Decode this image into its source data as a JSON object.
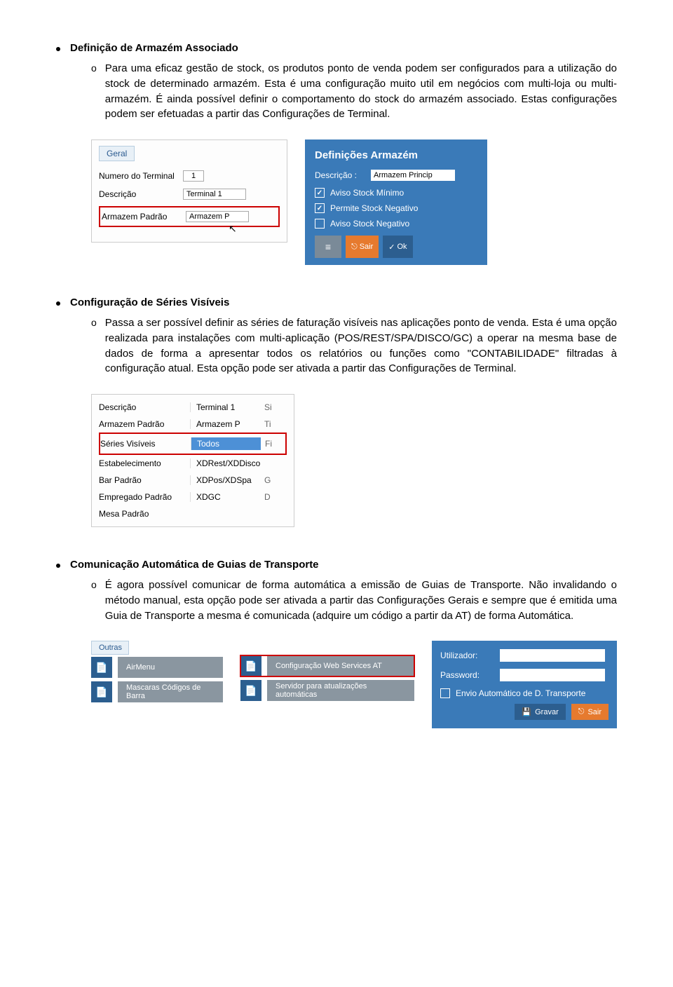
{
  "sec1": {
    "title": "Definição de Armazém Associado",
    "marker": "o",
    "body": "Para uma eficaz gestão de stock, os produtos ponto de venda podem ser configurados para a utilização do stock de determinado armazém. Esta é uma configuração muito util em negócios com multi-loja ou multi-armazém. É ainda possível definir o comportamento do stock do armazém associado. Estas configurações podem ser efetuadas a partir das Configurações de Terminal."
  },
  "geral": {
    "tab": "Geral",
    "num_label": "Numero do Terminal",
    "num_value": "1",
    "desc_label": "Descrição",
    "desc_value": "Terminal 1",
    "arm_label": "Armazem Padrão",
    "arm_value": "Armazem P"
  },
  "defarm": {
    "title": "Definições Armazém",
    "desc_label": "Descrição :",
    "desc_value": "Armazem Princip",
    "chk1": "Aviso Stock Mínimo",
    "chk2": "Permite Stock Negativo",
    "chk3": "Aviso Stock Negativo",
    "sair": "Sair",
    "ok": "Ok"
  },
  "sec2": {
    "title": "Configuração de Séries Visíveis",
    "marker": "o",
    "body": "Passa a ser possível definir as séries de faturação visíveis nas aplicações ponto de venda. Esta é uma opção realizada para instalações com multi-aplicação (POS/REST/SPA/DISCO/GC) a operar na mesma base de dados de forma a apresentar todos os relatórios ou funções como \"CONTABILIDADE\" filtradas à configuração atual. Esta opção pode ser ativada a partir das Configurações de Terminal."
  },
  "series": {
    "rows": [
      {
        "label": "Descrição",
        "value": "Terminal 1",
        "c3": "Si"
      },
      {
        "label": "Armazem Padrão",
        "value": "Armazem P",
        "c3": "Ti"
      },
      {
        "label": "Séries Visíveis",
        "value": "Todos",
        "c3": "Fi",
        "hl": true
      },
      {
        "label": "Estabelecimento",
        "value": "XDRest/XDDisco",
        "c3": ""
      },
      {
        "label": "Bar Padrão",
        "value": "XDPos/XDSpa",
        "c3": "G"
      },
      {
        "label": "Empregado Padrão",
        "value": "XDGC",
        "c3": "D"
      },
      {
        "label": "Mesa Padrão",
        "value": "",
        "c3": ""
      }
    ]
  },
  "sec3": {
    "title": "Comunicação Automática de Guias de Transporte",
    "marker": "o",
    "body": "É agora possível comunicar de forma automática a emissão de Guias de Transporte. Não invalidando o método manual, esta opção pode ser ativada a partir das Configurações Gerais e sempre que é emitida uma Guia de Transporte a mesma é comunicada (adquire um código a partir da AT) de forma Automática."
  },
  "bottom": {
    "tab": "Outras",
    "b1": "AirMenu",
    "b2": "Configuração Web Services AT",
    "b3": "Mascaras Códigos de Barra",
    "b4": "Servidor para atualizações automáticas"
  },
  "at": {
    "user_label": "Utilizador:",
    "pass_label": "Password:",
    "chk": "Envio Automático de D. Transporte",
    "save": "Gravar",
    "exit": "Sair"
  }
}
